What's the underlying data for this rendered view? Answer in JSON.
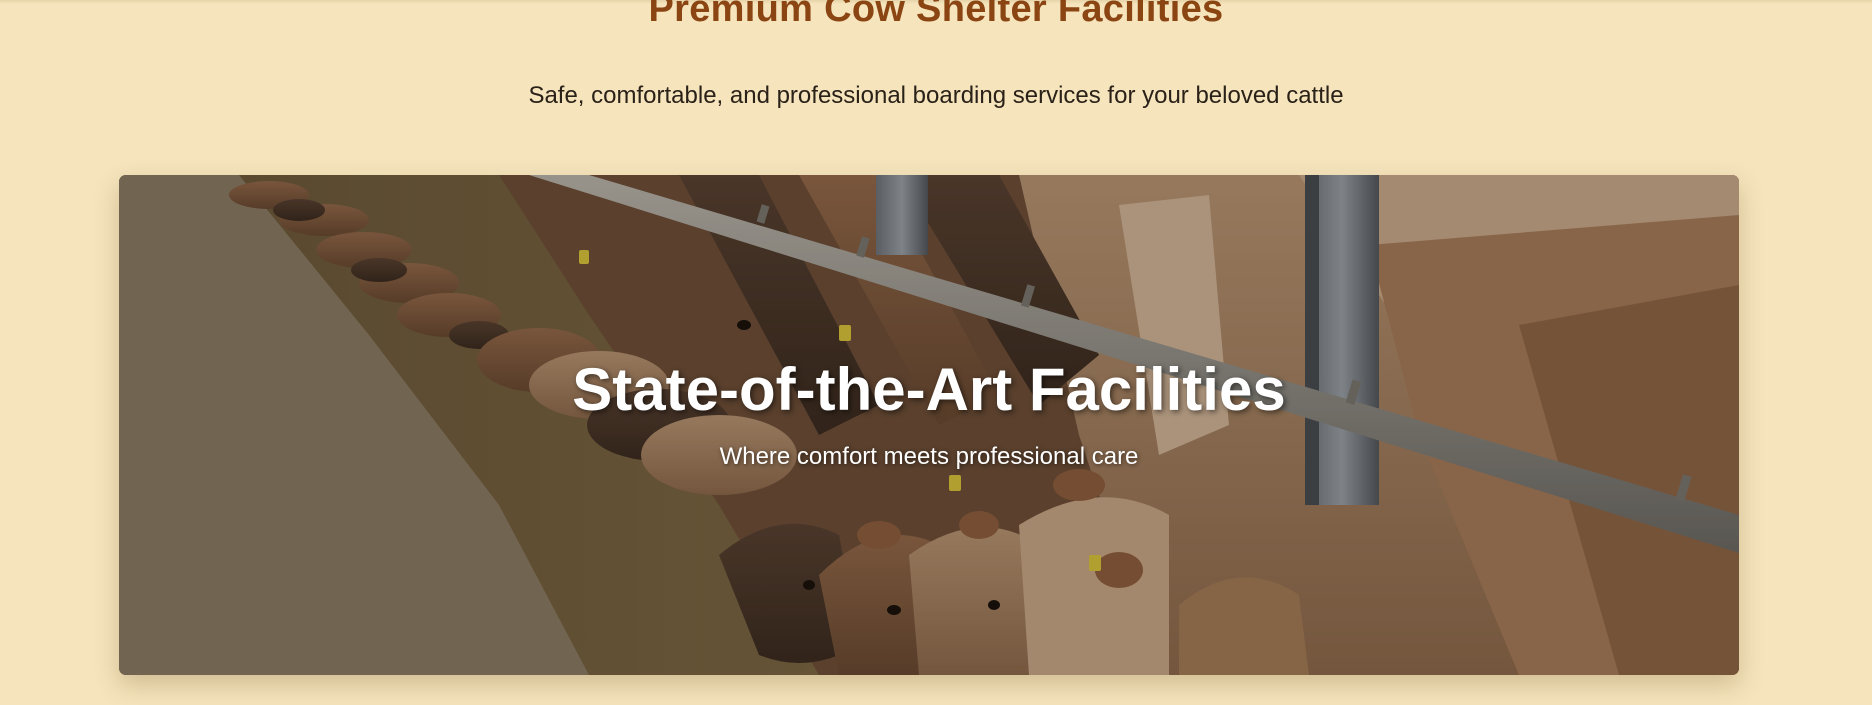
{
  "header": {
    "title": "Premium Cow Shelter Facilities",
    "subtitle": "Safe, comfortable, and professional boarding services for your beloved cattle"
  },
  "hero": {
    "image": "cattle-feeding-barn-photo",
    "title": "State-of-the-Art Facilities",
    "subtitle": "Where comfort meets professional care"
  },
  "colors": {
    "background": "#f5e4bc",
    "title": "#8b4513",
    "subtitle": "#2a2118",
    "hero_text": "#ffffff"
  }
}
